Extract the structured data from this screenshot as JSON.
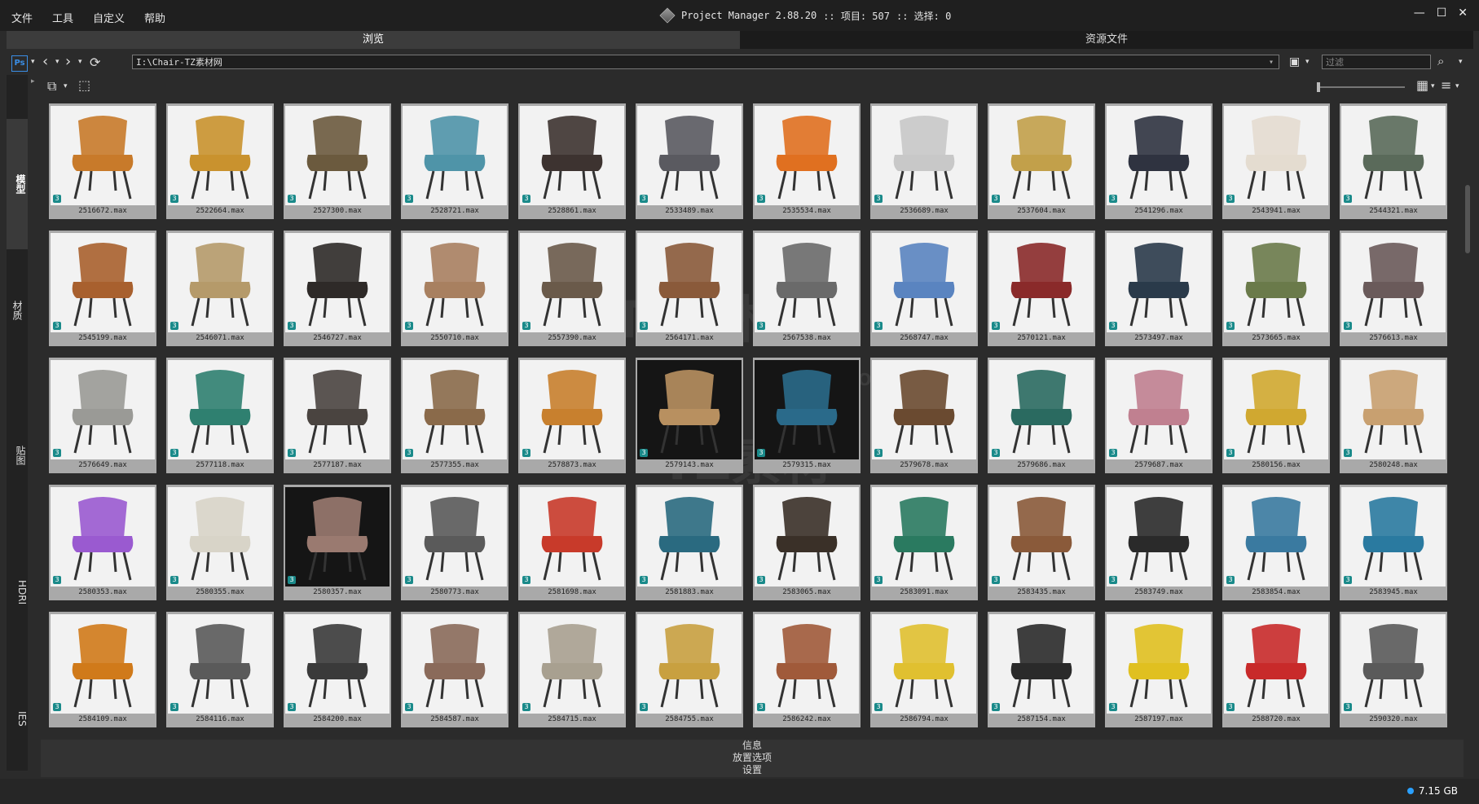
{
  "menu": [
    "文件",
    "工具",
    "自定义",
    "帮助"
  ],
  "window": {
    "title": "Project Manager 2.88.20",
    "items_label": ":: 项目: 507",
    "selection_label": ":: 选择: 0",
    "min": "—",
    "max": "☐",
    "close": "✕"
  },
  "tabs": [
    {
      "label": "浏览",
      "active": true
    },
    {
      "label": "资源文件",
      "active": false
    }
  ],
  "nav": {
    "ps_label": "Ps",
    "path": "I:\\Chair-TZ素材网",
    "filter_placeholder": "过滤"
  },
  "sidebar": [
    "模型",
    "材质",
    "贴图",
    "HDRI",
    "IES"
  ],
  "bottom_panels": [
    "信息",
    "放置选项",
    "设置"
  ],
  "status": {
    "disk": "7.15 GB"
  },
  "watermark": {
    "text1": "TZ素材网",
    "text2": "TZ素材",
    "text3": "TZSC.CC.COM"
  },
  "files": [
    "2516672.max",
    "2522664.max",
    "2527300.max",
    "2528721.max",
    "2528861.max",
    "2533489.max",
    "2535534.max",
    "2536689.max",
    "2537604.max",
    "2541296.max",
    "2543941.max",
    "2544321.max",
    "2545199.max",
    "2546071.max",
    "2546727.max",
    "2550710.max",
    "2557390.max",
    "2564171.max",
    "2567538.max",
    "2568747.max",
    "2570121.max",
    "2573497.max",
    "2573665.max",
    "2576613.max",
    "2576649.max",
    "2577118.max",
    "2577187.max",
    "2577355.max",
    "2578873.max",
    "2579143.max",
    "2579315.max",
    "2579678.max",
    "2579686.max",
    "2579687.max",
    "2580156.max",
    "2580248.max",
    "2580353.max",
    "2580355.max",
    "2580357.max",
    "2580773.max",
    "2581698.max",
    "2581883.max",
    "2583065.max",
    "2583091.max",
    "2583435.max",
    "2583749.max",
    "2583854.max",
    "2583945.max",
    "2584109.max",
    "2584116.max",
    "2584200.max",
    "2584587.max",
    "2584715.max",
    "2584755.max",
    "2586242.max",
    "2586794.max",
    "2587154.max",
    "2587197.max",
    "2588720.max",
    "2590320.max"
  ],
  "chair_colors": [
    "#c87a2a",
    "#c9922e",
    "#6b5a3e",
    "#4f94a8",
    "#3d3330",
    "#5a5a60",
    "#e07020",
    "#c8c8c8",
    "#c2a04a",
    "#2f3340",
    "#e4dcd0",
    "#5a6a5a",
    "#a8602e",
    "#b59a6a",
    "#2e2a28",
    "#a88060",
    "#6a5a4a",
    "#8a5a3a",
    "#6a6a6a",
    "#5a84c0",
    "#8a2a2a",
    "#2a3a4a",
    "#6a7a4a",
    "#6a5a5a",
    "#9a9a96",
    "#2f8070",
    "#4a4440",
    "#8a6a4a",
    "#c8802e",
    "#b89060",
    "#2a6a8a",
    "#6a4a30",
    "#2a6a60",
    "#c08090",
    "#d0a830",
    "#c8a070",
    "#9a5ad0",
    "#d8d4c8",
    "#9a7a70",
    "#5a5a5a",
    "#c83a2a",
    "#2a6a80",
    "#3a3028",
    "#2a7a60",
    "#8a5a3a",
    "#2a2a2a",
    "#3a7aa0",
    "#2a7aa0",
    "#d07a1a",
    "#5a5a5a",
    "#3a3a3a",
    "#8a6a5a",
    "#a8a090",
    "#c8a040",
    "#a05a3a",
    "#e0c030",
    "#2a2a2a",
    "#e0c020",
    "#c82a2a",
    "#5a5a5a"
  ],
  "dark_indices": [
    29,
    30,
    38
  ]
}
